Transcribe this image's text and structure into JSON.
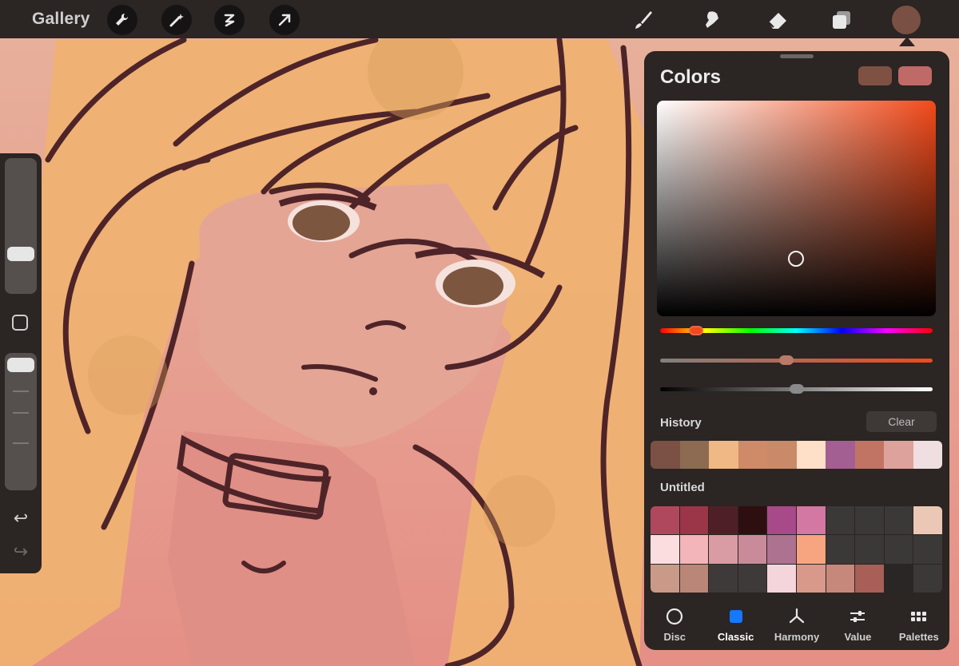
{
  "topbar": {
    "gallery_label": "Gallery",
    "left_tools": [
      "wrench-icon",
      "magic-wand-icon",
      "selection-icon",
      "transform-arrow-icon"
    ],
    "right_tools": [
      "brush-icon",
      "smudge-icon",
      "eraser-icon",
      "layers-icon"
    ],
    "current_color": "#7a4f44"
  },
  "sidebar": {
    "brush_size_level": 0.27,
    "opacity_level": 0.04
  },
  "colors_panel": {
    "title": "Colors",
    "primary_swatch": "#7f5142",
    "secondary_swatch": "#c06a68",
    "hue_color": "#f24a1a",
    "hue_position": 0.11,
    "saturation_position": 0.46,
    "brightness_position": 0.5,
    "history_label": "History",
    "clear_label": "Clear",
    "history": [
      "#7b5045",
      "#8c6b52",
      "#f0b884",
      "#cf8a67",
      "#c98a6a",
      "#fedfc8",
      "#a35f91",
      "#c27464",
      "#dea29c",
      "#efdfe0"
    ],
    "palette_label": "Untitled",
    "palette": [
      "#b0485d",
      "#9b3548",
      "#4f1f27",
      "#2e0f0f",
      "#a8498a",
      "#d377a3",
      "#3b3838",
      "#3b3838",
      "#3b3838",
      "#ebc8b6",
      "#fbdde0",
      "#f3b5ba",
      "#d99ba4",
      "#c98a99",
      "#ac7290",
      "#f7a580",
      "#3b3838",
      "#3b3838",
      "#3b3838",
      "#3b3838",
      "#c99a88",
      "#b98678",
      "#3e3a39",
      "#3e3a39",
      "#f4d5dc",
      "#d8988a",
      "#c6887a",
      "#a75f57",
      "#2a2626",
      "#3b3838"
    ],
    "tabs": [
      {
        "label": "Disc",
        "icon": "disc-icon",
        "active": false
      },
      {
        "label": "Classic",
        "icon": "classic-icon",
        "active": true
      },
      {
        "label": "Harmony",
        "icon": "harmony-icon",
        "active": false
      },
      {
        "label": "Value",
        "icon": "value-sliders-icon",
        "active": false
      },
      {
        "label": "Palettes",
        "icon": "palettes-grid-icon",
        "active": false
      }
    ]
  }
}
